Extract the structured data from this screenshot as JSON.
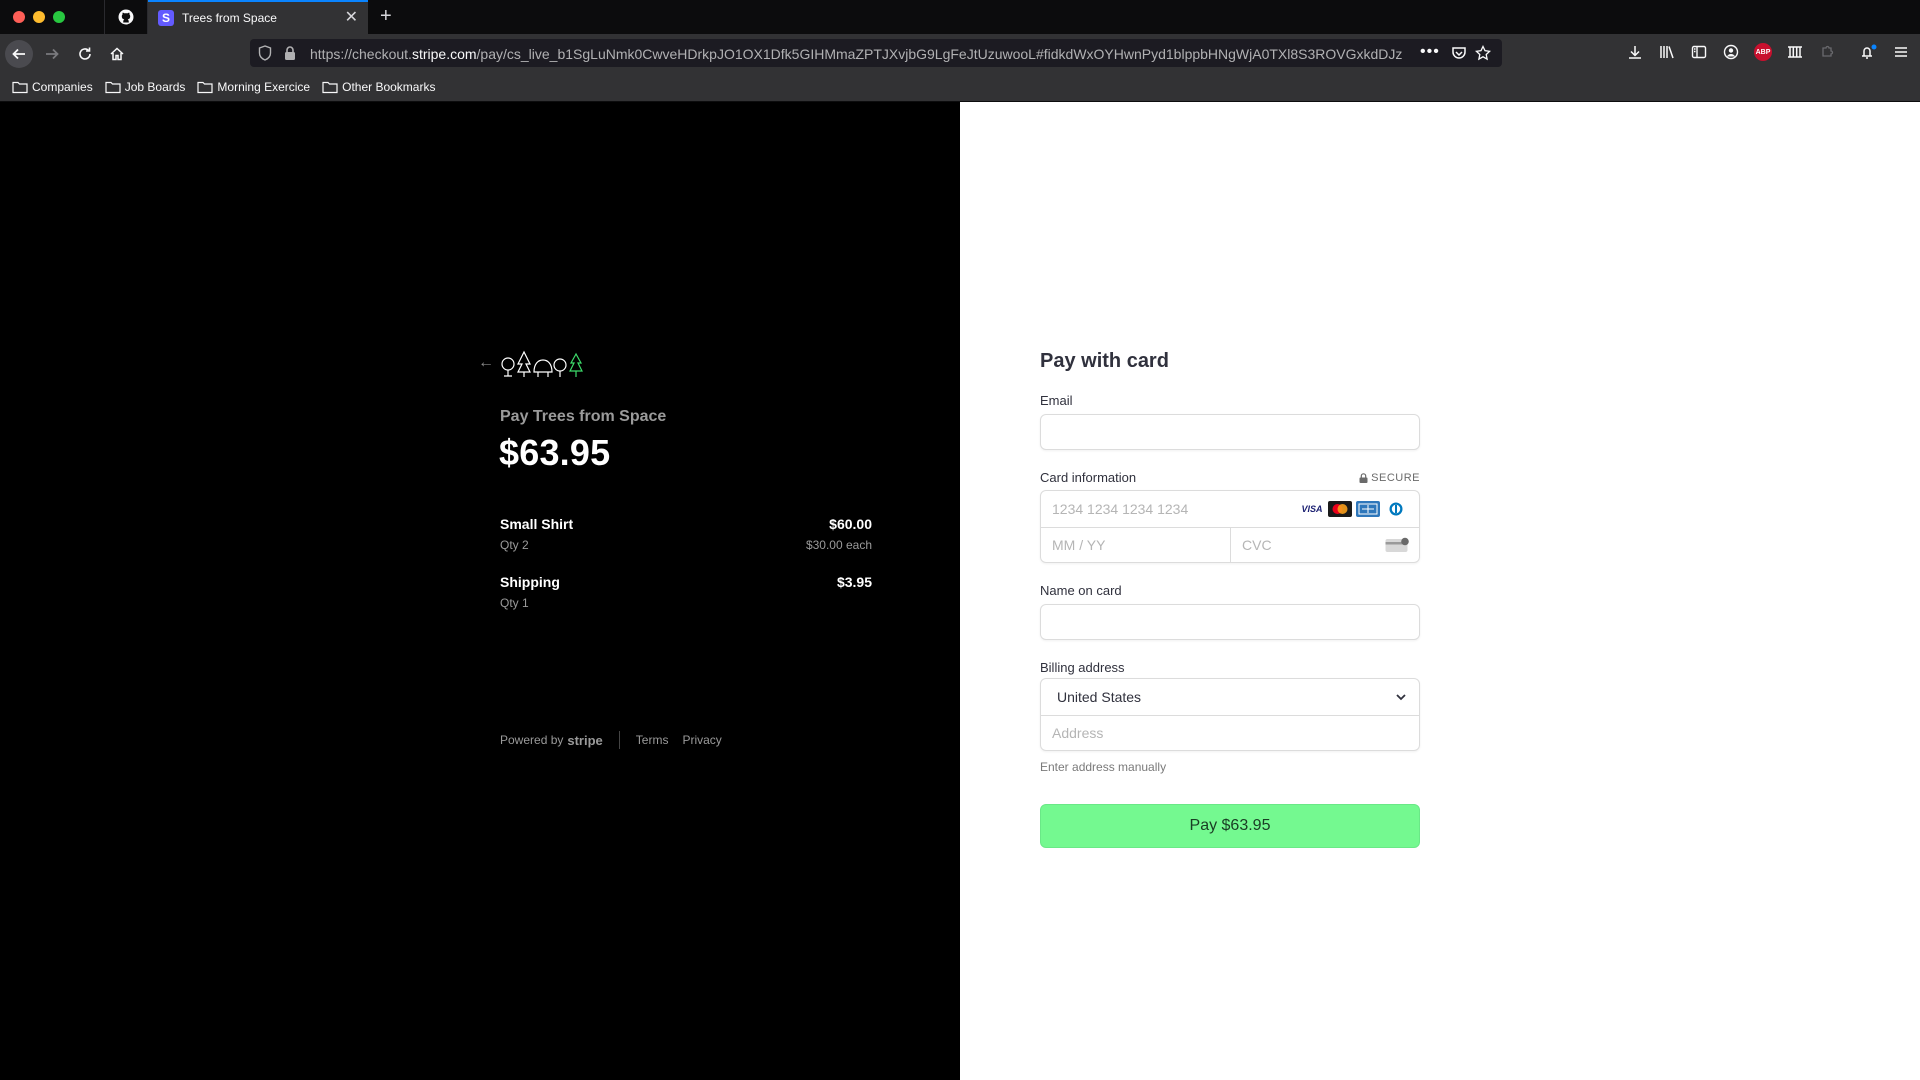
{
  "browser": {
    "tab_title": "Trees from Space",
    "tab_favicon_letter": "S",
    "url_prefix": "https://checkout.",
    "url_host": "stripe.com",
    "url_path": "/pay/cs_live_b1SgLuNmk0CwveHDrkpJO1OX1Dfk5GIHMmaZPTJXvjbG9LgFeJtUzuwooL#fidkdWxOYHwnPyd1blppbHNgWjA0TXl8S3ROVGxkdDJz",
    "abp_label": "ABP",
    "bookmarks": [
      {
        "label": "Companies"
      },
      {
        "label": "Job Boards"
      },
      {
        "label": "Morning Exercice"
      },
      {
        "label": "Other Bookmarks"
      }
    ]
  },
  "summary": {
    "merchant_line": "Pay Trees from Space",
    "total": "$63.95",
    "items": [
      {
        "name": "Small Shirt",
        "qty": "Qty 2",
        "amount": "$60.00",
        "each": "$30.00 each"
      },
      {
        "name": "Shipping",
        "qty": "Qty 1",
        "amount": "$3.95",
        "each": ""
      }
    ],
    "footer": {
      "powered_by": "Powered by",
      "stripe_word": "stripe",
      "terms": "Terms",
      "privacy": "Privacy"
    }
  },
  "form": {
    "title": "Pay with card",
    "email_label": "Email",
    "card_label": "Card information",
    "secure_label": "SECURE",
    "card_number_placeholder": "1234 1234 1234 1234",
    "expiry_placeholder": "MM / YY",
    "cvc_placeholder": "CVC",
    "visa_label": "VISA",
    "name_label": "Name on card",
    "billing_label": "Billing address",
    "country_value": "United States",
    "address_placeholder": "Address",
    "manual_link": "Enter address manually",
    "pay_button": "Pay $63.95"
  },
  "colors": {
    "pay_button": "#74f990",
    "tab_accent": "#0a84ff",
    "stripe_brand": "#635bff"
  }
}
